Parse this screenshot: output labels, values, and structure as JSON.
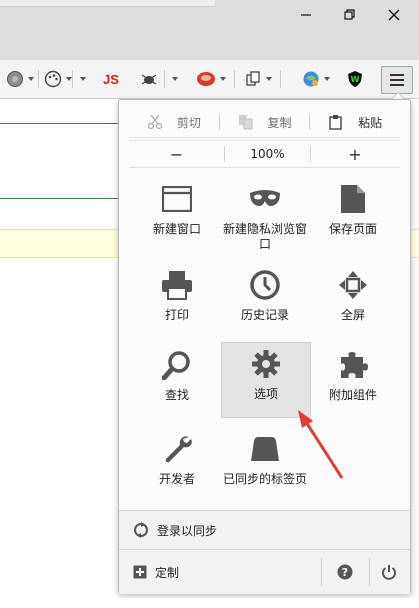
{
  "toolbar": {
    "js_label": "JS"
  },
  "menu": {
    "edit": {
      "cut": "剪切",
      "copy": "复制",
      "paste": "粘贴"
    },
    "zoom": {
      "minus": "−",
      "value": "100%",
      "plus": "+"
    },
    "items": [
      {
        "label": "新建窗口",
        "icon": "new-window-icon"
      },
      {
        "label": "新建隐私浏览窗口",
        "icon": "private-mask-icon"
      },
      {
        "label": "保存页面",
        "icon": "save-page-icon"
      },
      {
        "label": "打印",
        "icon": "printer-icon"
      },
      {
        "label": "历史记录",
        "icon": "history-clock-icon"
      },
      {
        "label": "全屏",
        "icon": "fullscreen-icon"
      },
      {
        "label": "查找",
        "icon": "search-icon"
      },
      {
        "label": "选项",
        "icon": "gear-icon"
      },
      {
        "label": "附加组件",
        "icon": "puzzle-icon"
      },
      {
        "label": "开发者",
        "icon": "wrench-icon"
      },
      {
        "label": "已同步的标签页",
        "icon": "synced-tabs-icon"
      }
    ],
    "sync_label": "登录以同步",
    "customize_label": "定制"
  },
  "colors": {
    "accent_red": "#e53935",
    "icon_gray": "#555555",
    "content_green": "#2e8b3a"
  }
}
